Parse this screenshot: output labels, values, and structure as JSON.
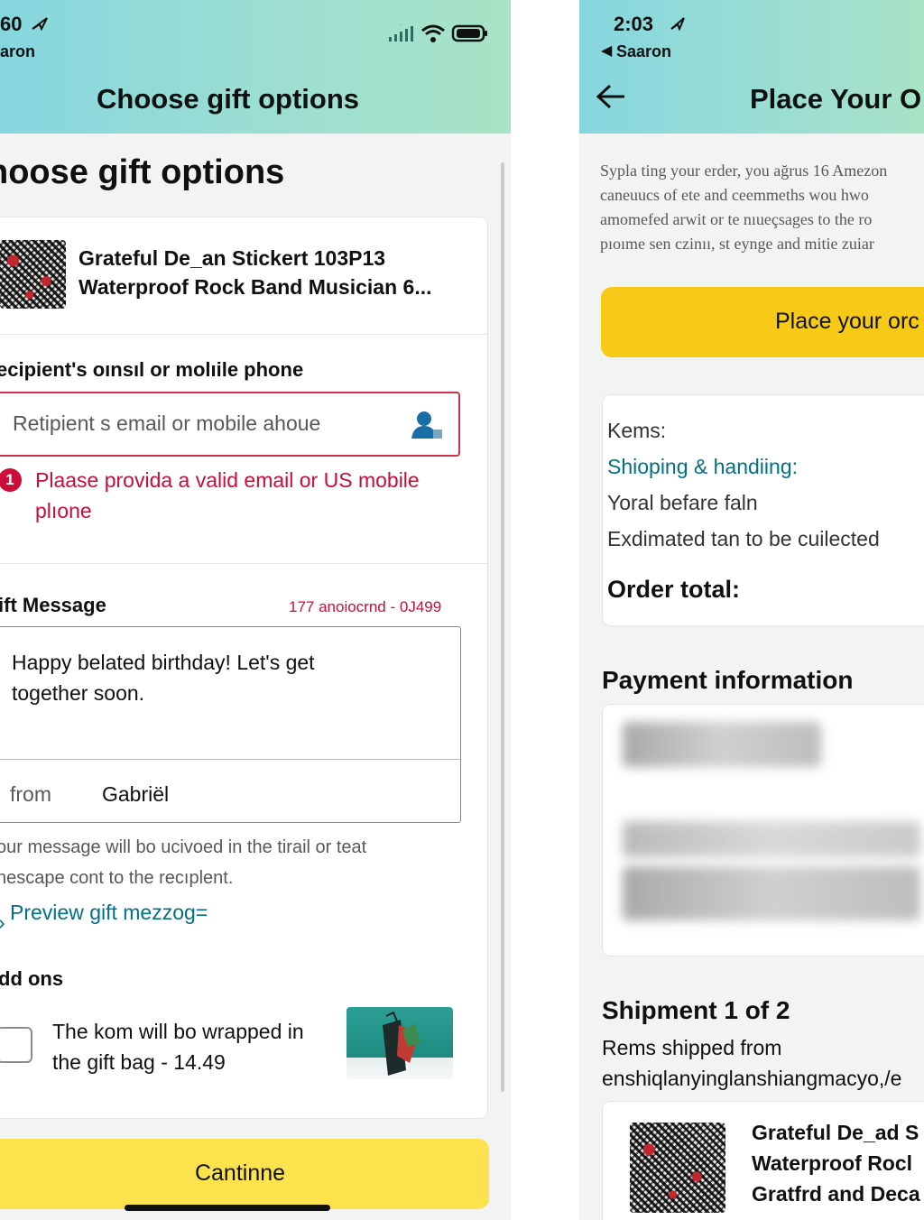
{
  "left_screen": {
    "status": {
      "time": "60",
      "carrier": "aron"
    },
    "header": {
      "title": "Choose gift options"
    },
    "page_heading": "hoose gift options",
    "product": {
      "title_line1": "Grateful De_an Stickert 103P13",
      "title_line2": "Waterproof Rock Band Musician 6..."
    },
    "recipient": {
      "label": "ecipient's oınsıl or molıile phone",
      "placeholder": "Retipient s email or mobile ahoue",
      "error_line1": "Plaase provida a valid email or US mobile",
      "error_line2": "plıone",
      "error_badge": "1"
    },
    "gift_message": {
      "label": "ift Message",
      "counter": "177 anoiocrnd - 0J499",
      "text_line1": "Happy belated birthday! Let's get",
      "text_line2": "together soon.",
      "from_label": "from",
      "from_value": "Gabriël"
    },
    "helper_line1": "our message will bo ucivoed in the tirail or teat",
    "helper_line2": "nescape cont to the recıplent.",
    "preview_link": "Preview gift mezzog=",
    "addons": {
      "label": "dd ons",
      "text_line1": "The kom will bo wrapped in",
      "text_line2": "the gift bag - 14.49"
    },
    "continue_label": "Cantinne"
  },
  "right_screen": {
    "status": {
      "time": "2:03",
      "carrier": "Saaron"
    },
    "header": {
      "title": "Place Your O"
    },
    "legal_lines": [
      "Sypla ting your erder, you ağrus 16 Amezon",
      "caneuucs of ete and ceemmeths wou hwo",
      "amomefed arwit or te nıueçsages to the ro",
      "pıoıme sen czinıı, st eynge and mitie zuiar"
    ],
    "place_order_label": "Place your orc",
    "summary": {
      "items": "Kems:",
      "shipping": "Shioping & handiing:",
      "before_tax": "Yoral befare faln",
      "est_tax": "Exdimated tan to be cuilected",
      "order_total": "Order total:"
    },
    "payment_heading": "Payment information",
    "shipment": {
      "heading": "Shipment 1 of 2",
      "sub_line1": "Rems shipped from",
      "sub_line2": "enshiqlanyinglanshiangmacyo,/e"
    },
    "product": {
      "line1": "Grateful De_ad S",
      "line2": "Waterproof Rocl",
      "line3": "Gratfrd and Deca"
    }
  },
  "icons": {
    "signal": "signal-icon",
    "wifi": "wifi-icon",
    "battery": "battery-icon",
    "contact": "contact-icon",
    "back": "back-arrow-icon",
    "location": "location-arrow-icon"
  },
  "colors": {
    "header_gradient_start": "#86d6df",
    "header_gradient_end": "#a8e3c6",
    "error": "#cc0c39",
    "link": "#007185",
    "button_yellow": "#fce24d",
    "place_order_yellow": "#f7ca18"
  }
}
